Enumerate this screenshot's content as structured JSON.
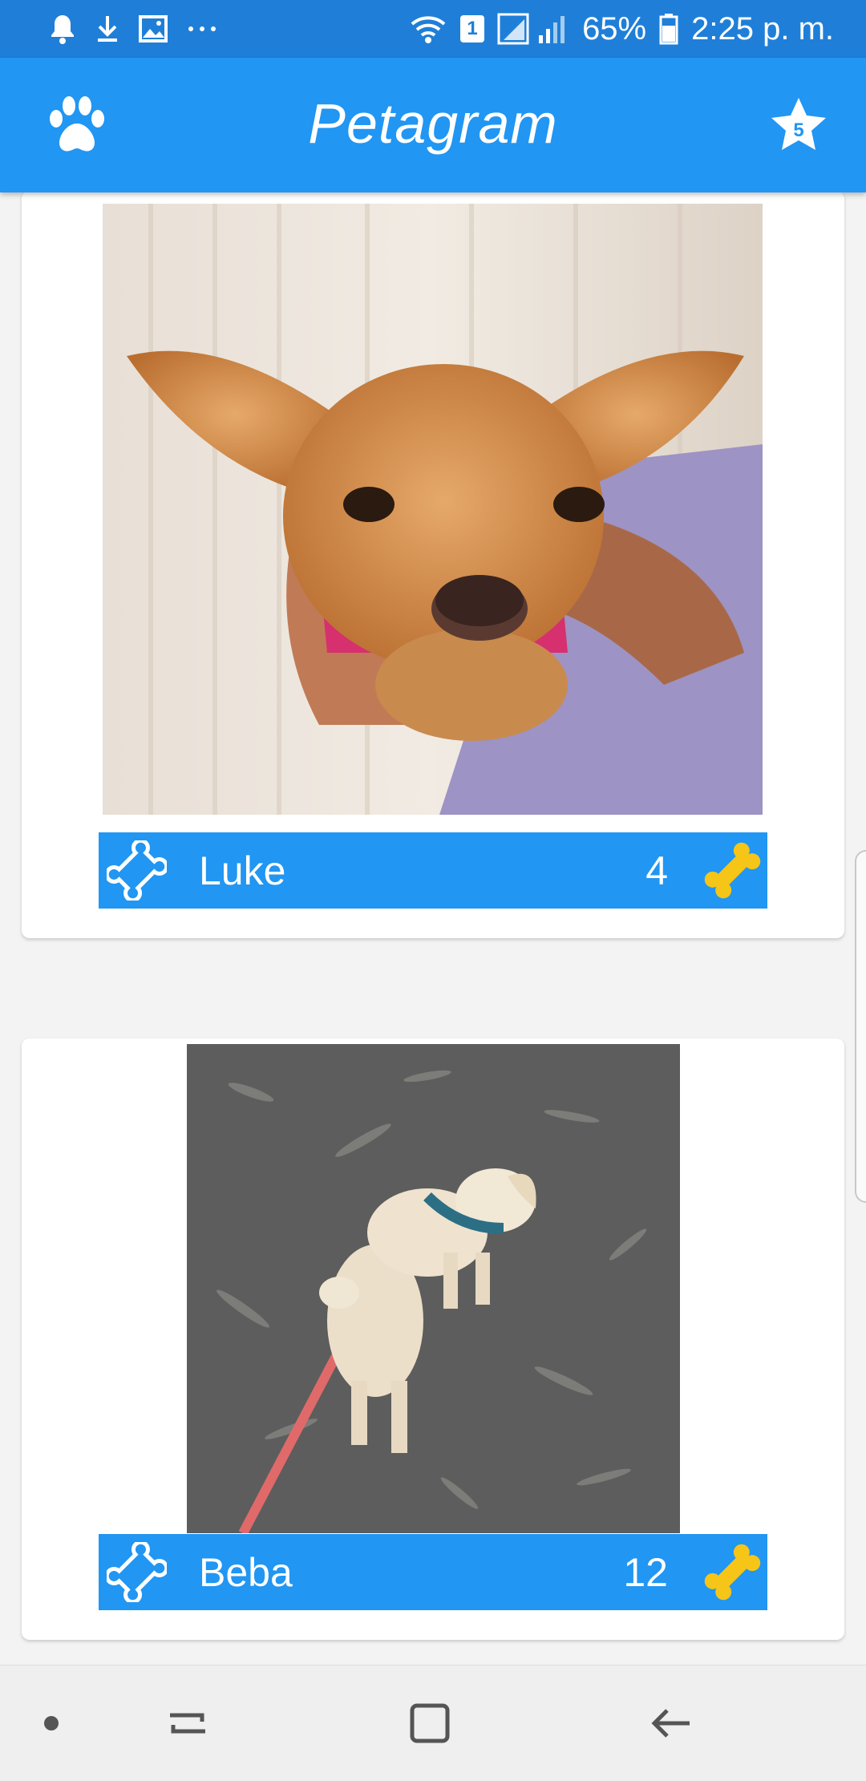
{
  "status_bar": {
    "battery": "65%",
    "sim_slot": "1",
    "time": "2:25 p. m.",
    "icons": [
      "notification-bell-icon",
      "download-icon",
      "image-icon",
      "more-dots-icon",
      "wifi-icon",
      "signal-icon",
      "battery-icon"
    ]
  },
  "app_bar": {
    "title": "Petagram",
    "favorites_count": "5",
    "icons": [
      "paw-icon",
      "star-icon"
    ]
  },
  "pets": [
    {
      "name": "Luke",
      "likes": "4"
    },
    {
      "name": "Beba",
      "likes": "12"
    }
  ],
  "colors": {
    "primary": "#2196f3",
    "primary_dark": "#1f7fd8",
    "bone_yellow": "#f5c518",
    "background": "#f3f3f3"
  },
  "nav_bar": {
    "icons": [
      "dot-icon",
      "recents-icon",
      "home-icon",
      "back-icon"
    ]
  }
}
